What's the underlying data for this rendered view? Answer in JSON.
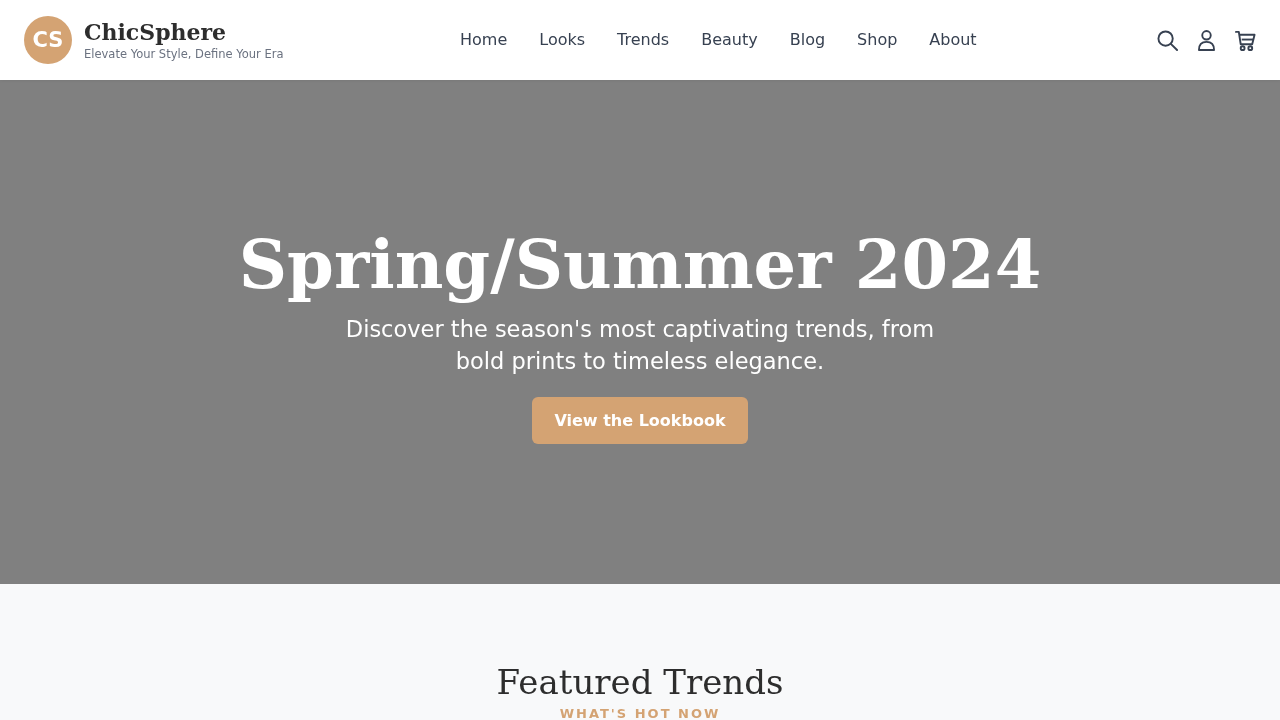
{
  "header": {
    "logo": {
      "initials": "CS",
      "name": "ChicSphere",
      "tagline": "Elevate Your Style, Define Your Era"
    },
    "nav": [
      {
        "label": "Home"
      },
      {
        "label": "Looks"
      },
      {
        "label": "Trends"
      },
      {
        "label": "Beauty"
      },
      {
        "label": "Blog"
      },
      {
        "label": "Shop"
      },
      {
        "label": "About"
      }
    ]
  },
  "hero": {
    "title": "Spring/Summer 2024",
    "subtitle": "Discover the season's most captivating trends, from bold prints to timeless elegance.",
    "button": "View the Lookbook"
  },
  "featured": {
    "title": "Featured Trends",
    "subtitle": "WHAT'S HOT NOW"
  }
}
